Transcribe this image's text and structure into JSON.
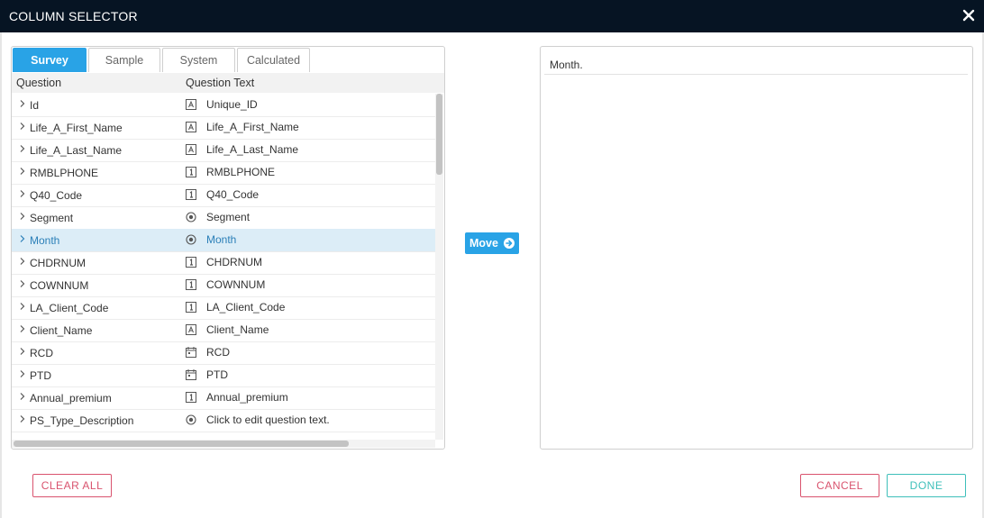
{
  "dialog": {
    "title": "COLUMN SELECTOR"
  },
  "tabs": [
    {
      "label": "Survey",
      "active": true
    },
    {
      "label": "Sample",
      "active": false
    },
    {
      "label": "System",
      "active": false
    },
    {
      "label": "Calculated",
      "active": false
    }
  ],
  "grid": {
    "col_question": "Question",
    "col_question_text": "Question Text",
    "rows": [
      {
        "name": "Id",
        "text": "Unique_ID",
        "icon": "text-type-icon"
      },
      {
        "name": "Life_A_First_Name",
        "text": "Life_A_First_Name",
        "icon": "text-type-icon"
      },
      {
        "name": "Life_A_Last_Name",
        "text": "Life_A_Last_Name",
        "icon": "text-type-icon"
      },
      {
        "name": "RMBLPHONE",
        "text": "RMBLPHONE",
        "icon": "number-type-icon"
      },
      {
        "name": "Q40_Code",
        "text": "Q40_Code",
        "icon": "number-type-icon"
      },
      {
        "name": "Segment",
        "text": "Segment",
        "icon": "single-choice-icon"
      },
      {
        "name": "Month",
        "text": "Month",
        "icon": "single-choice-icon",
        "selected": true
      },
      {
        "name": "CHDRNUM",
        "text": "CHDRNUM",
        "icon": "number-type-icon"
      },
      {
        "name": "COWNNUM",
        "text": "COWNNUM",
        "icon": "number-type-icon"
      },
      {
        "name": "LA_Client_Code",
        "text": "LA_Client_Code",
        "icon": "number-type-icon"
      },
      {
        "name": "Client_Name",
        "text": "Client_Name",
        "icon": "text-type-icon"
      },
      {
        "name": "RCD",
        "text": "RCD",
        "icon": "date-type-icon"
      },
      {
        "name": "PTD",
        "text": "PTD",
        "icon": "date-type-icon"
      },
      {
        "name": "Annual_premium",
        "text": "Annual_premium",
        "icon": "number-type-icon"
      },
      {
        "name": "PS_Type_Description",
        "text": "Click to edit question text.",
        "icon": "single-choice-icon"
      }
    ]
  },
  "move_button": {
    "label": "Move",
    "icon": "arrow-right-circle-icon"
  },
  "selected_columns": [
    "Month."
  ],
  "buttons": {
    "clear_all": "CLEAR ALL",
    "cancel": "CANCEL",
    "done": "DONE"
  },
  "colors": {
    "titlebar": "#061423",
    "accent": "#29a3e6",
    "danger": "#d9536e",
    "success": "#3ebfba",
    "selected_row": "#dcedf7"
  }
}
